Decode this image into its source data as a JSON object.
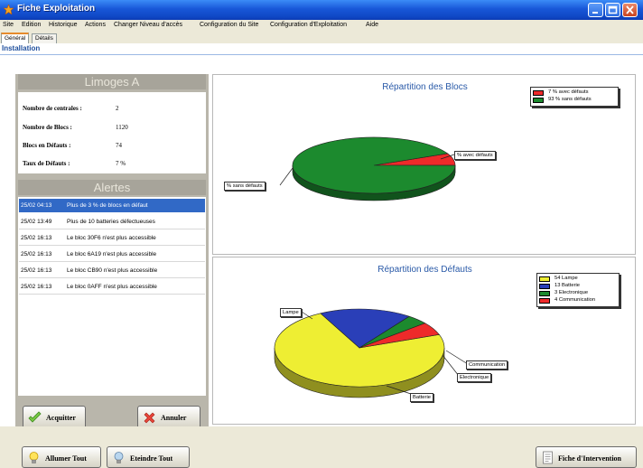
{
  "window": {
    "title": "Fiche Exploitation"
  },
  "menu": [
    "Site",
    "Edition",
    "Historique",
    "Actions",
    "Changer Niveau d'accès",
    "Configuration du Site",
    "Configuration d'Exploitation",
    "Aide"
  ],
  "tabs": [
    "Général",
    "Détails"
  ],
  "installation_label": "Installation",
  "site": {
    "name": "Limoges A",
    "fields": [
      {
        "label": "Nombre de centrales :",
        "value": "2"
      },
      {
        "label": "Nombre de Blocs :",
        "value": "1120"
      },
      {
        "label": "Blocs en Défauts :",
        "value": "74"
      },
      {
        "label": "Taux de Défauts :",
        "value": "7 %"
      }
    ]
  },
  "alerts": {
    "title": "Alertes",
    "rows": [
      {
        "date": "25/02 04:13",
        "message": "Plus de 3 % de blocs en défaut",
        "selected": true
      },
      {
        "date": "25/02 13:49",
        "message": "Plus de 10 batteries défectueuses",
        "selected": false
      },
      {
        "date": "25/02 16:13",
        "message": "Le bloc 30F6 n'est plus accessible",
        "selected": false
      },
      {
        "date": "25/02 16:13",
        "message": "Le bloc 6A19 n'est plus accessible",
        "selected": false
      },
      {
        "date": "25/02 16:13",
        "message": "Le bloc CB90 n'est plus accessible",
        "selected": false
      },
      {
        "date": "25/02 16:13",
        "message": "Le bloc 0AFF n'est plus accessible",
        "selected": false
      }
    ]
  },
  "buttons": {
    "acquitter": "Acquitter",
    "annuler": "Annuler",
    "allumer": "Allumer Tout",
    "eteindre": "Eteindre Tout",
    "fiche": "Fiche d'Intervention"
  },
  "chart_data": [
    {
      "type": "pie",
      "title": "Répartition des Blocs",
      "categories": [
        "avec défauts",
        "sans défauts"
      ],
      "values": [
        7,
        93
      ],
      "legend": [
        "7 % avec défauts",
        "93 % sans défauts"
      ],
      "callouts": [
        "% avec défauts",
        "% sans défauts"
      ],
      "colors": [
        "#ee2a2a",
        "#1c8a2e"
      ],
      "legend_position": "top-right"
    },
    {
      "type": "pie",
      "title": "Répartition des Défauts",
      "categories": [
        "Lampe",
        "Batterie",
        "Electronique",
        "Communication"
      ],
      "values": [
        54,
        13,
        3,
        4
      ],
      "legend": [
        "54 Lampe",
        "13 Batterie",
        "3 Electronique",
        "4 Communication"
      ],
      "callouts": [
        "Lampe",
        "Batterie",
        "Electronique",
        "Communication"
      ],
      "colors": [
        "#eeee33",
        "#2a3fb8",
        "#1c8a2e",
        "#ee2a2a"
      ],
      "legend_position": "top-right"
    }
  ]
}
